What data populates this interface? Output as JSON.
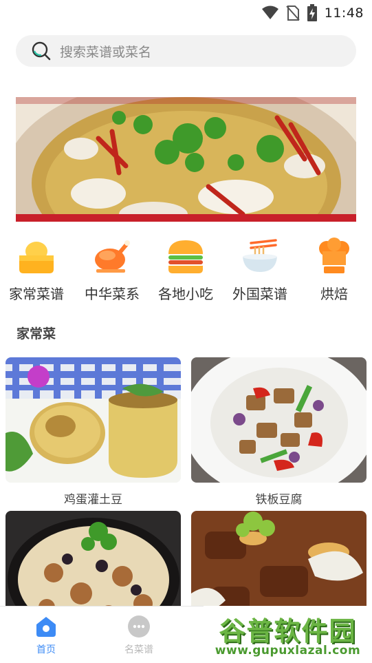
{
  "status": {
    "time": "11:48"
  },
  "search": {
    "placeholder": "搜索菜谱或菜名"
  },
  "categories": [
    {
      "label": "家常菜谱",
      "icon": "tofu-icon"
    },
    {
      "label": "中华菜系",
      "icon": "roast-chicken-icon"
    },
    {
      "label": "各地小吃",
      "icon": "burger-icon"
    },
    {
      "label": "外国菜谱",
      "icon": "noodle-bowl-icon"
    },
    {
      "label": "烘焙",
      "icon": "chef-hat-icon"
    }
  ],
  "section": {
    "title": "家常菜"
  },
  "recipes": [
    {
      "name": "鸡蛋灌土豆"
    },
    {
      "name": "铁板豆腐"
    },
    {
      "name": ""
    },
    {
      "name": ""
    }
  ],
  "nav": {
    "items": [
      {
        "label": "首页",
        "active": true
      },
      {
        "label": "名菜谱",
        "active": false
      }
    ]
  },
  "watermark": {
    "title": "谷普软件园",
    "url": "www.gupuxlazal.com"
  },
  "colors": {
    "accent": "#3d8bf5",
    "inactive": "#b8b8b8",
    "watermark": "#6bb544"
  }
}
